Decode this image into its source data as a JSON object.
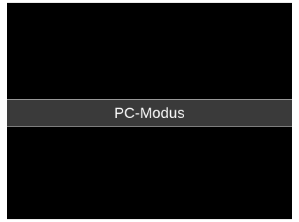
{
  "screen": {
    "mode_label": "PC-Modus"
  },
  "colors": {
    "screen_background": "#000000",
    "banner_background": "#3a3a3a",
    "banner_border": "#9a9a9a",
    "text": "#ffffff"
  }
}
